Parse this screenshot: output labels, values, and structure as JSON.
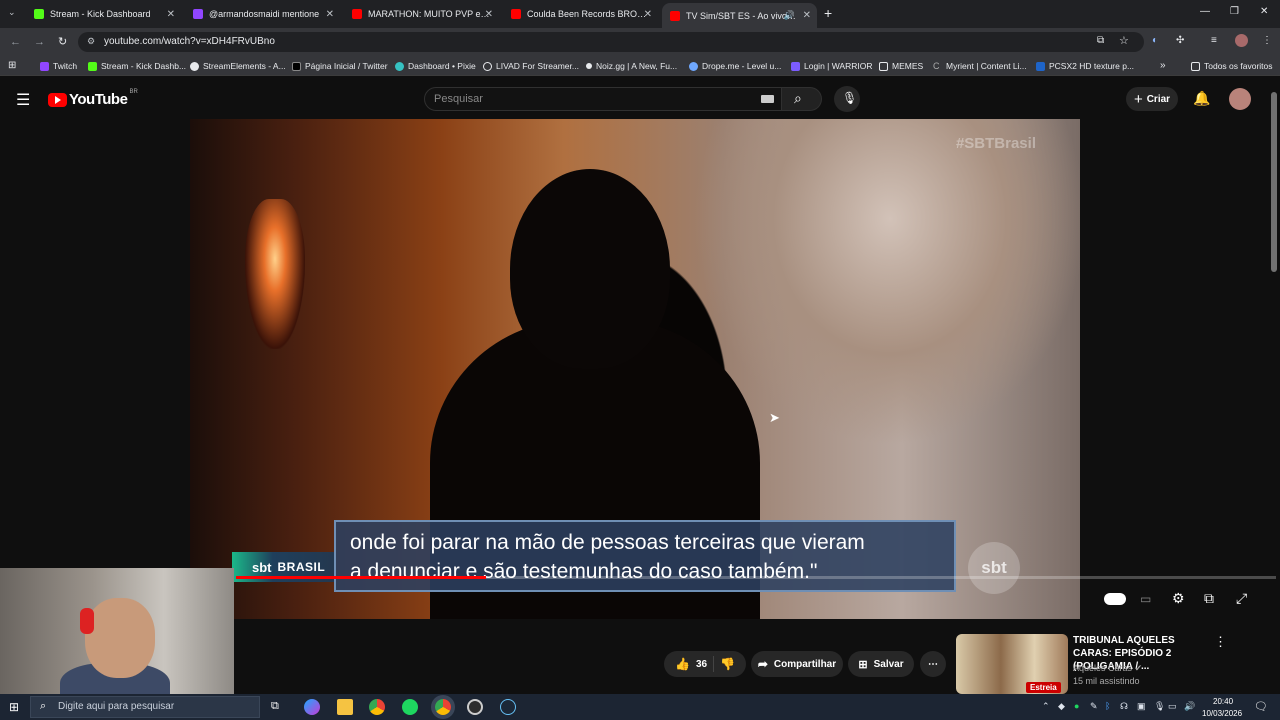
{
  "browser": {
    "tabs": [
      {
        "title": "Stream - Kick Dashboard",
        "color": "#53fc18"
      },
      {
        "title": "@armandosmaidi mentione",
        "color": "#9146ff"
      },
      {
        "title": "MARATHON: MUITO PVP e EVE",
        "color": "#ff0000"
      },
      {
        "title": "Coulda Been Records BROOKL",
        "color": "#ff0000"
      },
      {
        "title": "TV Sim/SBT ES - Ao vivo - Y",
        "color": "#ff0000"
      }
    ],
    "url": "youtube.com/watch?v=xDH4FRvUBno",
    "bookmarks": [
      "Twitch",
      "Stream - Kick Dashb...",
      "StreamElements - A...",
      "Página Inicial / Twitter",
      "Dashboard • Pixie",
      "LIVAD For Streamer...",
      "Noiz.gg | A New, Fu...",
      "Drope.me - Level u...",
      "Login | WARRIOR",
      "MEMES",
      "Myrient | Content Li...",
      "PCSX2 HD texture p..."
    ],
    "all_bookmarks": "Todos os favoritos"
  },
  "youtube": {
    "logo": "YouTube",
    "region": "BR",
    "search_placeholder": "Pesquisar",
    "create_label": "Criar"
  },
  "video": {
    "watermark": "#SBTBrasil",
    "badge_brand": "sbt",
    "badge_text": "BRASIL",
    "caption_line1": "onde foi parar na mão de pessoas terceiras que vieram",
    "caption_line2": "a denunciar e são testemunhas do caso também.\"",
    "logo_text": "sbt",
    "progress": 0.24
  },
  "actions": {
    "likes": "36",
    "share_label": "Compartilhar",
    "save_label": "Salvar"
  },
  "suggestion": {
    "title": "TRIBUNAL AQUELES CARAS: EPISÓDIO 2 (POLIGAMIA / ...",
    "channel": "Aqueles Caras",
    "viewers": "15 mil assistindo",
    "badge": "Estreia"
  },
  "taskbar": {
    "search_placeholder": "Digite aqui para pesquisar",
    "time": "20:40",
    "date": "10/03/2026"
  }
}
